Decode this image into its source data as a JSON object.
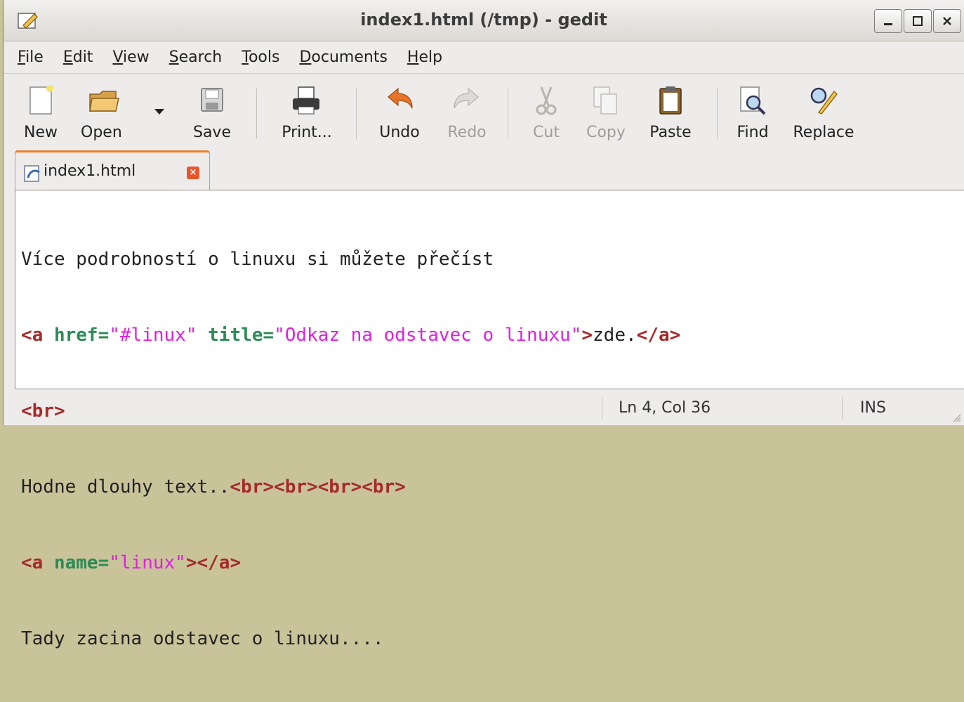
{
  "window": {
    "title": "index1.html (/tmp) - gedit"
  },
  "menu": [
    {
      "label": "File",
      "mn": "F",
      "rest": "ile"
    },
    {
      "label": "Edit",
      "mn": "E",
      "rest": "dit"
    },
    {
      "label": "View",
      "mn": "V",
      "rest": "iew"
    },
    {
      "label": "Search",
      "mn": "S",
      "rest": "earch"
    },
    {
      "label": "Tools",
      "mn": "T",
      "rest": "ools"
    },
    {
      "label": "Documents",
      "mn": "D",
      "rest": "ocuments"
    },
    {
      "label": "Help",
      "mn": "H",
      "rest": "elp"
    }
  ],
  "toolbar": {
    "new": "New",
    "open": "Open",
    "save": "Save",
    "print": "Print...",
    "undo": "Undo",
    "redo": "Redo",
    "cut": "Cut",
    "copy": "Copy",
    "paste": "Paste",
    "find": "Find",
    "replace": "Replace"
  },
  "tab": {
    "label": "index1.html",
    "close": "×"
  },
  "editor": {
    "line1": "Více podrobností o linuxu si můžete přečíst",
    "line2": {
      "open": "<a ",
      "href_attr": "href=",
      "href_val": "\"#linux\"",
      "title_attr": "title=",
      "title_val": "\"Odkaz na odstavec o linuxu\"",
      "gt": ">",
      "text": "zde.",
      "close": "</a>"
    },
    "line3": "<br>",
    "line4": {
      "text": "Hodne dlouhy text..",
      "tags": "<br><br><br><br>"
    },
    "line5": {
      "open": "<a ",
      "name_attr": "name=",
      "name_val": "\"linux\"",
      "end": "></a>"
    },
    "line6": "Tady zacina odstavec o linuxu...."
  },
  "status": {
    "position": "Ln 4, Col 36",
    "mode": "INS"
  },
  "colors": {
    "tag": "#a52a2a",
    "attribute": "#2e8b57",
    "string": "#e020e0",
    "tab_accent": "#e87f2b"
  }
}
